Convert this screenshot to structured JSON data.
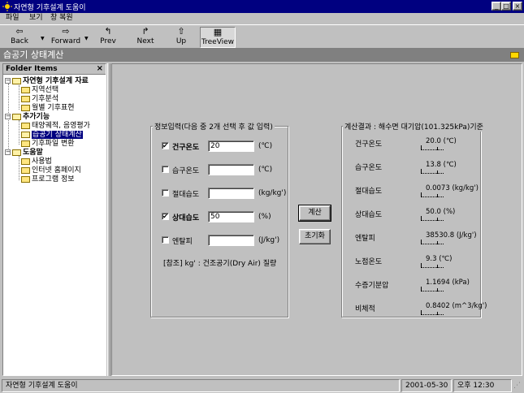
{
  "window": {
    "title": "자연형 기후설계 도움이",
    "controls": [
      "_",
      "□",
      "×"
    ]
  },
  "menu": [
    "파일",
    "보기",
    "창 복원"
  ],
  "toolbar": [
    {
      "label": "Back",
      "glyph": "⇦",
      "dropdown": true
    },
    {
      "label": "Forward",
      "glyph": "⇨",
      "dropdown": true
    },
    {
      "label": "Prev",
      "glyph": "↰"
    },
    {
      "label": "Next",
      "glyph": "↱"
    },
    {
      "label": "Up",
      "glyph": "⇧"
    },
    {
      "label": "TreeView",
      "glyph": "▦",
      "pressed": true
    }
  ],
  "header": {
    "title": "습공기 상태계산"
  },
  "tree": {
    "title": "Folder Items",
    "close": "×",
    "groups": [
      {
        "label": "자연형 기후설계 자료",
        "expander": "−",
        "children": [
          "지역선택",
          "기후분석",
          "월별 기후표현"
        ]
      },
      {
        "label": "추가기능",
        "expander": "−",
        "children": [
          "태양궤적, 음영평가",
          "습공기 상태계산",
          "기후파일 변환"
        ],
        "selected": "습공기 상태계산"
      },
      {
        "label": "도움말",
        "expander": "−",
        "children": [
          "사용법",
          "인터넷 홈페이지",
          "프로그램 정보"
        ]
      }
    ]
  },
  "input_group": {
    "title": "정보입력(다음 중 2개 선택 후 값 입력)",
    "fields": [
      {
        "label": "건구온도",
        "checked": true,
        "value": "20",
        "unit": "(℃)"
      },
      {
        "label": "습구온도",
        "checked": false,
        "value": "",
        "unit": "(℃)"
      },
      {
        "label": "절대습도",
        "checked": false,
        "value": "",
        "unit": "(kg/kg')"
      },
      {
        "label": "상대습도",
        "checked": true,
        "value": "50",
        "unit": "(%)"
      },
      {
        "label": "엔탈피",
        "checked": false,
        "value": "",
        "unit": "(J/kg')"
      }
    ],
    "note": "[참조] kg' : 건조공기(Dry Air) 질량",
    "check_mark": "✔"
  },
  "buttons": {
    "calc": "계산",
    "reset": "초기화"
  },
  "result_group": {
    "title": "계산결과 : 해수면 대기압(101.325kPa)기준",
    "rows": [
      {
        "label": "건구온도",
        "value": "20.0 (℃)"
      },
      {
        "label": "습구온도",
        "value": "13.8 (℃)"
      },
      {
        "label": "절대습도",
        "value": "0.0073 (kg/kg')"
      },
      {
        "label": "상대습도",
        "value": "50.0 (%)"
      },
      {
        "label": "엔탈피",
        "value": "38530.8 (J/kg')"
      },
      {
        "label": "노점온도",
        "value": "9.3 (℃)"
      },
      {
        "label": "수증기분압",
        "value": "1.1694 (kPa)"
      },
      {
        "label": "비체적",
        "value": "0.8402 (m^3/kg')"
      }
    ]
  },
  "status": {
    "app": "자연형 기후설계 도움이",
    "date": "2001-05-30",
    "time": "오후 12:30"
  },
  "colors": {
    "titlebar": "#000080",
    "face": "#c0c0c0",
    "header": "#808080",
    "selection": "#000080"
  }
}
